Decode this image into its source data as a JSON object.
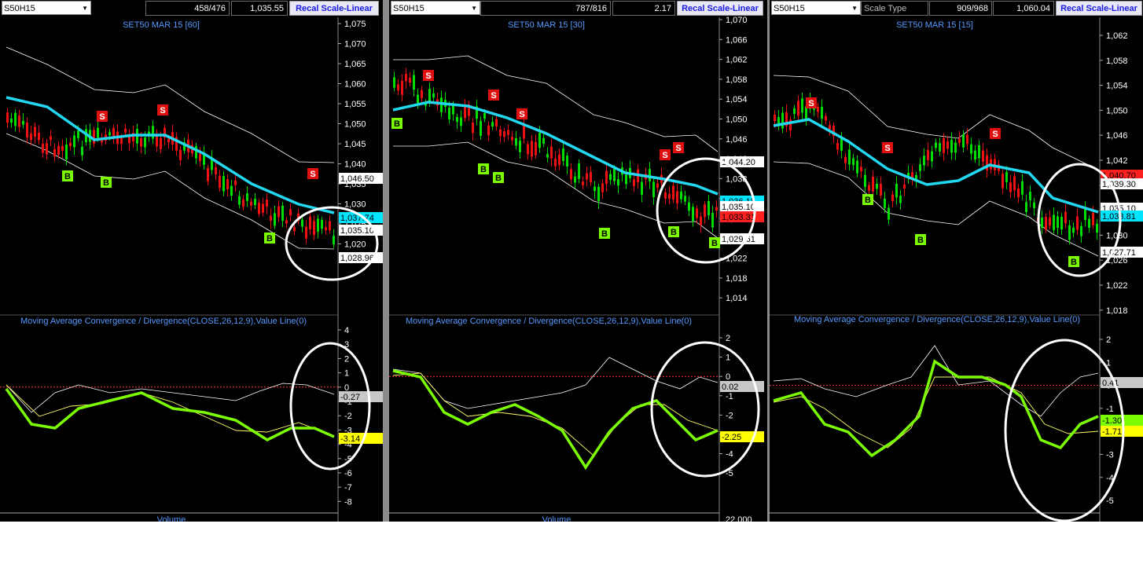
{
  "panels": [
    {
      "symbol": "S50H15",
      "extra_label": "",
      "count": "458/476",
      "value": "1,035.55",
      "recal": "Recal Scale-Linear",
      "title": "SET50 MAR 15  [60]",
      "price_ticks": [
        "1,075",
        "1,070",
        "1,065",
        "1,060",
        "1,055",
        "1,050",
        "1,045",
        "1,040",
        "1,035",
        "1,030",
        "1,025",
        "1,020"
      ],
      "price_tags": [
        {
          "text": "1,046.50",
          "color": "#ffffff"
        },
        {
          "text": "1,037.74",
          "color": "#00e5ff"
        },
        {
          "text": "1,035.10",
          "color": "#ffffff"
        },
        {
          "text": "1,028.96",
          "color": "#ffffff"
        }
      ],
      "macd_title": "Moving Average Convergence / Divergence(CLOSE,26,12,9),Value Line(0)",
      "macd_ticks": [
        "4",
        "3",
        "2",
        "1",
        "0",
        "-1",
        "-2",
        "-3",
        "-4",
        "-5",
        "-6",
        "-7",
        "-8"
      ],
      "macd_tags": [
        {
          "text": "-0.27",
          "color": "#c8c8c8"
        },
        {
          "text": "-3.14",
          "color": "#ffff00"
        }
      ],
      "volume_label": "Volume",
      "volume_tick": "",
      "signals": [
        {
          "type": "S",
          "label": "S"
        },
        {
          "type": "S",
          "label": "S"
        },
        {
          "type": "S",
          "label": "S"
        },
        {
          "type": "B",
          "label": "B"
        },
        {
          "type": "B",
          "label": "B"
        },
        {
          "type": "B",
          "label": "B"
        }
      ]
    },
    {
      "symbol": "S50H15",
      "extra_label": "",
      "count": "787/816",
      "value": "2.17",
      "recal": "Recal Scale-Linear",
      "title": "SET50 MAR 15  [30]",
      "price_ticks": [
        "1,070",
        "1,066",
        "1,062",
        "1,058",
        "1,054",
        "1,050",
        "1,046",
        "1,042",
        "1,038",
        "1,034",
        "1,030",
        "1,026",
        "1,022",
        "1,018",
        "1,014"
      ],
      "price_tags": [
        {
          "text": "1,044.20",
          "color": "#ffffff"
        },
        {
          "text": "1,036.11",
          "color": "#00e5ff"
        },
        {
          "text": "1,035.10",
          "color": "#ffffff"
        },
        {
          "text": "1,033.31",
          "color": "#ff2020"
        },
        {
          "text": "1,029.61",
          "color": "#ffffff"
        }
      ],
      "macd_title": "Moving Average Convergence / Divergence(CLOSE,26,12,9),Value Line(0)",
      "macd_ticks": [
        "2",
        "1",
        "0",
        "-1",
        "-2",
        "-3",
        "-4",
        "-5"
      ],
      "macd_tags": [
        {
          "text": "0.02",
          "color": "#c8c8c8"
        },
        {
          "text": "-2.25",
          "color": "#ffff00"
        }
      ],
      "volume_label": "Volume",
      "volume_tick": "22,000",
      "signals": [
        {
          "type": "S",
          "label": "S"
        },
        {
          "type": "S",
          "label": "S"
        },
        {
          "type": "S",
          "label": "S"
        },
        {
          "type": "S",
          "label": "S"
        },
        {
          "type": "S",
          "label": "S"
        },
        {
          "type": "B",
          "label": "B"
        },
        {
          "type": "B",
          "label": "B"
        },
        {
          "type": "B",
          "label": "B"
        },
        {
          "type": "B",
          "label": "B"
        },
        {
          "type": "B",
          "label": "B"
        },
        {
          "type": "B",
          "label": "B"
        }
      ]
    },
    {
      "symbol": "S50H15",
      "extra_label": "Scale Type",
      "count": "909/968",
      "value": "1,060.04",
      "recal": "Recal Scale-Linear",
      "title": "SET50 MAR 15  [15]",
      "price_ticks": [
        "1,062",
        "1,058",
        "1,054",
        "1,050",
        "1,046",
        "1,042",
        "1,038",
        "1,034",
        "1,030",
        "1,026",
        "1,022",
        "1,018"
      ],
      "price_tags": [
        {
          "text": "1,040.70",
          "color": "#ff2020"
        },
        {
          "text": "1,039.30",
          "color": "#ffffff"
        },
        {
          "text": "1,035.10",
          "color": "#ffffff"
        },
        {
          "text": "1,033.81",
          "color": "#00e5ff"
        },
        {
          "text": "1,027.71",
          "color": "#ffffff"
        }
      ],
      "macd_title": "Moving Average Convergence / Divergence(CLOSE,26,12,9),Value Line(0)",
      "macd_ticks": [
        "2",
        "1",
        "0",
        "-1",
        "-2",
        "-3",
        "-4",
        "-5"
      ],
      "macd_tags": [
        {
          "text": "0.41",
          "color": "#c8c8c8"
        },
        {
          "text": "-1.30",
          "color": "#7cfc00"
        },
        {
          "text": "-1.71",
          "color": "#ffff00"
        }
      ],
      "volume_label": "",
      "volume_tick": "",
      "signals": [
        {
          "type": "S",
          "label": "S"
        },
        {
          "type": "S",
          "label": "S"
        },
        {
          "type": "S",
          "label": "S"
        },
        {
          "type": "B",
          "label": "B"
        },
        {
          "type": "B",
          "label": "B"
        },
        {
          "type": "B",
          "label": "B"
        }
      ]
    }
  ],
  "colors": {
    "up_candle": "#00dd00",
    "down_candle": "#ee1111",
    "ma_line": "#22d8f0",
    "bands": "#ffffff",
    "macd_line": "#7cfc00",
    "signal_line": "#ffff66",
    "axis_text": "#ffffff",
    "title_text": "#5599ff",
    "zero_line": "#ff3333",
    "highlight_circle": "#ffffff"
  },
  "icons": [
    "dropdown-arrow-icon"
  ]
}
